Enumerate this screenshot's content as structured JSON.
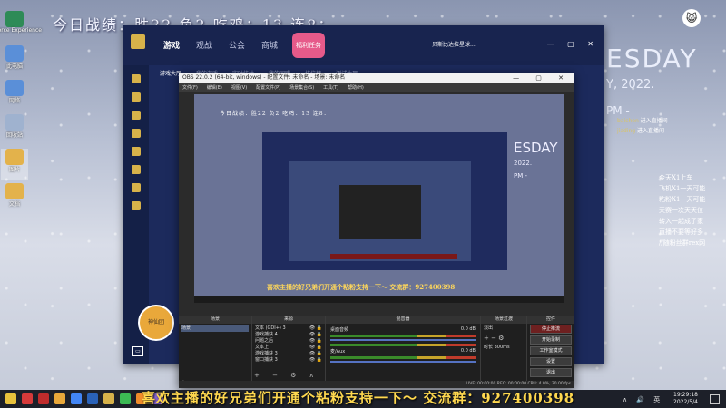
{
  "overlay": {
    "stats": "今日战绩：胜22  负2    吃鸡：13   连8："
  },
  "desktop": {
    "icons": [
      {
        "label": "GeForce Experience",
        "color": "#2e8b57"
      },
      {
        "label": "此电脑",
        "color": "#5a8fd8"
      },
      {
        "label": "网络",
        "color": "#5a8fd8"
      },
      {
        "label": "回收站",
        "color": "#9fb2cf"
      },
      {
        "label": "图片",
        "color": "#e3b24b"
      },
      {
        "label": "文档",
        "color": "#e3b24b"
      }
    ]
  },
  "background": {
    "word": "ESDAY",
    "date": "Y, 2022.",
    "pm": "PM -"
  },
  "chat_side": [
    {
      "user": "baichen",
      "text": "进入直播间"
    },
    {
      "user": "jiading",
      "text": "进入直播间"
    }
  ],
  "side_text": [
    "今天X1上车",
    "飞机X1一天可能",
    "粘粉X1一天可能",
    "天赛一次天天位",
    "转入一起成了家",
    "直播不要等好多",
    "//随粉丝群rex网"
  ],
  "client": {
    "nav": [
      {
        "label": "游戏",
        "active": true
      },
      {
        "label": "观战",
        "active": false
      },
      {
        "label": "公会",
        "active": false
      },
      {
        "label": "商城",
        "active": false
      }
    ],
    "event_badge": "福利任务",
    "user": "贝斯比达拉星球...",
    "sub_tabs": [
      {
        "label": "游戏大厅",
        "active": true
      },
      {
        "label": "我的游戏",
        "active": false
      },
      {
        "label": "实时统计",
        "active": false
      },
      {
        "label": "我的同盟",
        "active": false
      },
      {
        "label": "排位榜",
        "active": false
      },
      {
        "label": "测试大厅",
        "active": false
      }
    ]
  },
  "obs": {
    "title": "OBS 22.0.2 (64-bit, windows) - 配置文件: 未命名 - 场景: 未命名",
    "menu": [
      "文件(F)",
      "编辑(E)",
      "视图(V)",
      "配置文件(P)",
      "场景集合(S)",
      "工具(T)",
      "帮助(H)"
    ],
    "preview": {
      "stats": "今日战绩：胜22  负2    吃鸡：13   连8：",
      "word": "ESDAY",
      "date": "2022.",
      "pm": "PM -",
      "marquee": "喜欢主播的好兄弟们开通个粘粉支持一下～ 交流群：927400398"
    },
    "docks": {
      "scenes_label": "场景",
      "scenes": [
        "场景"
      ],
      "sources_label": "来源",
      "sources": [
        "文本 (GDI+) 3",
        "游戏捕获 4",
        "问题之后",
        "文本上",
        "游戏捕获 3",
        "窗口捕获 3"
      ],
      "mixer_label": "混音器",
      "mixer": [
        {
          "name": "桌面音频",
          "db": "0.0 dB"
        },
        {
          "name": "麦/Aux",
          "db": "0.0 dB"
        }
      ],
      "transitions_label": "场景过渡",
      "transition": "淡出",
      "duration_label": "时长",
      "duration": "300ms",
      "controls_label": "控件",
      "controls": [
        "停止推流",
        "开始录制",
        "工作室模式",
        "设置",
        "退出"
      ]
    },
    "status": "LIVE: 00:00:00   REC: 00:00:00   CPU: 4.0%, 30.00 fps"
  },
  "mascot_label": "神仙团",
  "marquee": "喜欢主播的好兄弟们开通个粘粉支持一下～ 交流群：927400398",
  "taskbar": {
    "icons": [
      "#e8c23c",
      "#d63a3a",
      "#bf2c2c",
      "#e9a83a",
      "#4285f4",
      "#2a62b8",
      "#d7b24a",
      "#3cba54",
      "#f08c2a",
      "#8a66d6"
    ],
    "tray": "∧ 🔊 英",
    "time": "19:29:18",
    "date": "2022/5/4"
  }
}
